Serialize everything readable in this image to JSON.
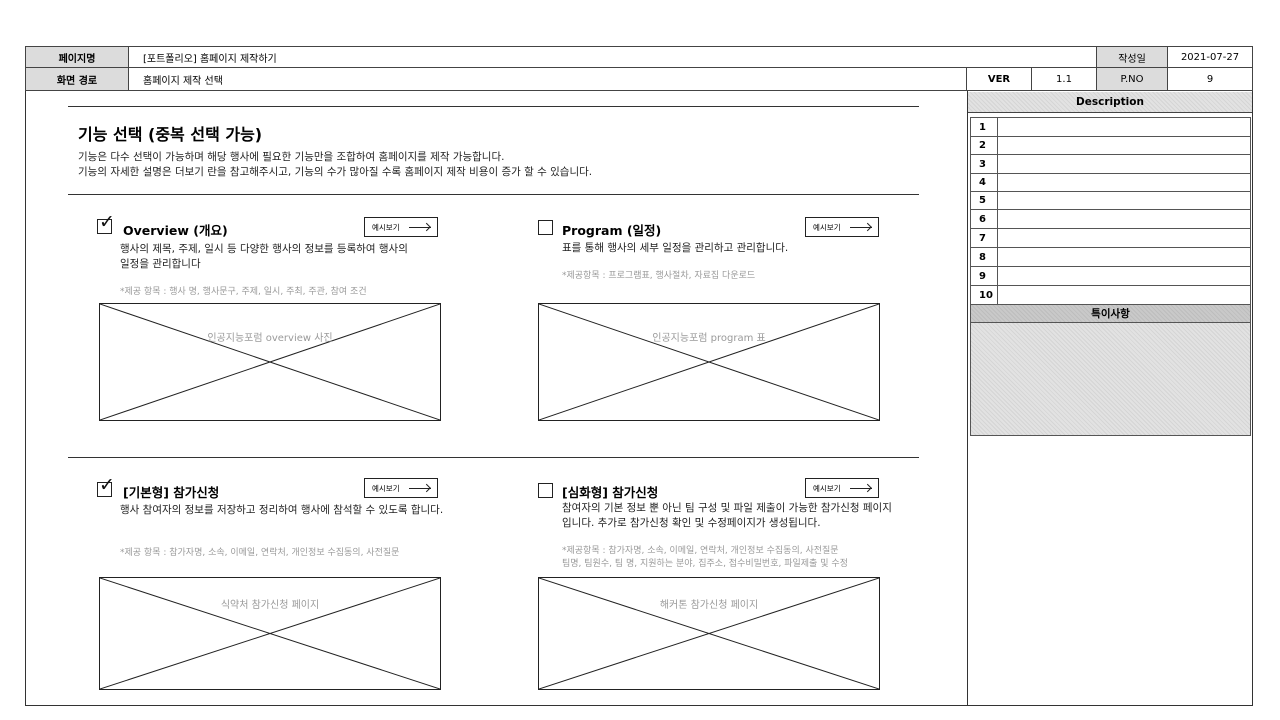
{
  "header": {
    "page_name_label": "페이지명",
    "page_name": "[포트폴리오] 홈페이지 제작하기",
    "date_label": "작성일",
    "date": "2021-07-27",
    "path_label": "화면 경로",
    "path": "홈페이지 제작 선택",
    "ver_label": "VER",
    "ver": "1.1",
    "pno_label": "P.NO",
    "pno": "9"
  },
  "main": {
    "title": "기능 선택 (중복 선택 가능)",
    "desc_line1": "기능은 다수 선택이 가능하며 해당 행사에 필요한 기능만을 조합하여 홈페이지를 제작 가능합니다.",
    "desc_line2": "기능의 자세한 설명은 더보기 란을 참고해주시고, 기능의 수가 많아질 수록 홈페이지 제작 비용이 증가 할 수 있습니다.",
    "features": [
      {
        "title": "Overview (개요)",
        "checked": true,
        "preview_label": "예시보기",
        "desc": "행사의 제목, 주제, 일시 등 다양한 행사의 정보를 등록하여 행사의 일정을 관리합니다",
        "items": "*제공 항목 : 행사 명, 행사문구, 주제, 일시, 주최, 주관, 참여 조건",
        "image_label": "인공지능포럼 overview 사진"
      },
      {
        "title": "Program (일정)",
        "checked": false,
        "preview_label": "예시보기",
        "desc": "표를 통해 행사의 세부 일정을 관리하고 관리합니다.",
        "items": "*제공항목 : 프로그램표, 행사절차, 자료집 다운로드",
        "image_label": "인공지능포럼 program 표"
      },
      {
        "title": "[기본형] 참가신청",
        "checked": true,
        "preview_label": "예시보기",
        "desc": "행사 참여자의 정보를 저장하고 정리하여 행사에 참석할 수 있도록 합니다.",
        "items": "*제공 항목 : 참가자명, 소속, 이메일, 연락처, 개인정보 수집동의, 사전질문",
        "image_label": "식약처 참가신청 페이지"
      },
      {
        "title": "[심화형] 참가신청",
        "checked": false,
        "preview_label": "예시보기",
        "desc": "참여자의 기본 정보 뿐 아닌 팀 구성 및 파일 제출이 가능한 참가신청 페이지입니다. 추가로 참가신청 확인 및 수정페이지가 생성됩니다.",
        "items": "*제공항목 : 참가자명, 소속, 이메일, 연락처, 개인정보 수집동의, 사전질문",
        "items2": "팀명, 팀원수, 팀 명, 지원하는 분야, 집주소, 접수비밀번호, 파일제출 및 수정",
        "image_label": "해커톤 참가신청 페이지"
      }
    ]
  },
  "side": {
    "description_header": "Description",
    "rows": [
      "1",
      "2",
      "3",
      "4",
      "5",
      "6",
      "7",
      "8",
      "9",
      "10"
    ],
    "notes_header": "특이사항"
  }
}
